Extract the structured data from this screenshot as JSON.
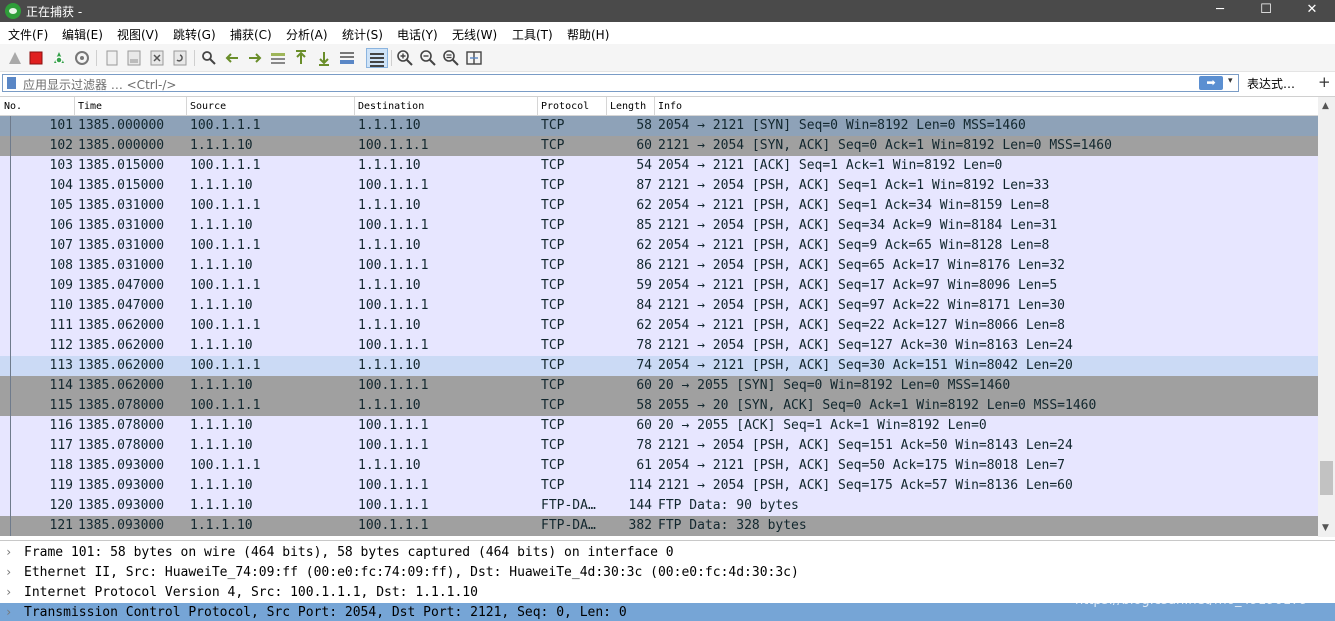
{
  "window": {
    "title": "正在捕获 -",
    "controls": {
      "minimize": "─",
      "maximize": "☐",
      "close": "✕"
    }
  },
  "menu": [
    "文件(F)",
    "编辑(E)",
    "视图(V)",
    "跳转(G)",
    "捕获(C)",
    "分析(A)",
    "统计(S)",
    "电话(Y)",
    "无线(W)",
    "工具(T)",
    "帮助(H)"
  ],
  "filter": {
    "placeholder": "应用显示过滤器 … <Ctrl-/>",
    "apply_icon": "➡",
    "dropdown_icon": "▾",
    "expression_label": "表达式…",
    "add_label": "+"
  },
  "columns": [
    "No.",
    "Time",
    "Source",
    "Destination",
    "Protocol",
    "Length",
    "Info"
  ],
  "colors": {
    "tcp_row": "#e7e6ff",
    "syn_row": "#a0a0a0",
    "selected_row": "#8ea2b8",
    "highlight_row": "#cbdaf5",
    "details_selected": "#76a5d6"
  },
  "packets": [
    {
      "no": "101",
      "time": "1385.000000",
      "src": "100.1.1.1",
      "dst": "1.1.1.10",
      "proto": "TCP",
      "len": "58",
      "info": "2054 → 2121 [SYN] Seq=0 Win=8192 Len=0 MSS=1460",
      "style": "selected"
    },
    {
      "no": "102",
      "time": "1385.000000",
      "src": "1.1.1.10",
      "dst": "100.1.1.1",
      "proto": "TCP",
      "len": "60",
      "info": "2121 → 2054 [SYN, ACK] Seq=0 Ack=1 Win=8192 Len=0 MSS=1460",
      "style": "syn"
    },
    {
      "no": "103",
      "time": "1385.015000",
      "src": "100.1.1.1",
      "dst": "1.1.1.10",
      "proto": "TCP",
      "len": "54",
      "info": "2054 → 2121 [ACK] Seq=1 Ack=1 Win=8192 Len=0",
      "style": "tcp"
    },
    {
      "no": "104",
      "time": "1385.015000",
      "src": "1.1.1.10",
      "dst": "100.1.1.1",
      "proto": "TCP",
      "len": "87",
      "info": "2121 → 2054 [PSH, ACK] Seq=1 Ack=1 Win=8192 Len=33",
      "style": "tcp"
    },
    {
      "no": "105",
      "time": "1385.031000",
      "src": "100.1.1.1",
      "dst": "1.1.1.10",
      "proto": "TCP",
      "len": "62",
      "info": "2054 → 2121 [PSH, ACK] Seq=1 Ack=34 Win=8159 Len=8",
      "style": "tcp"
    },
    {
      "no": "106",
      "time": "1385.031000",
      "src": "1.1.1.10",
      "dst": "100.1.1.1",
      "proto": "TCP",
      "len": "85",
      "info": "2121 → 2054 [PSH, ACK] Seq=34 Ack=9 Win=8184 Len=31",
      "style": "tcp"
    },
    {
      "no": "107",
      "time": "1385.031000",
      "src": "100.1.1.1",
      "dst": "1.1.1.10",
      "proto": "TCP",
      "len": "62",
      "info": "2054 → 2121 [PSH, ACK] Seq=9 Ack=65 Win=8128 Len=8",
      "style": "tcp"
    },
    {
      "no": "108",
      "time": "1385.031000",
      "src": "1.1.1.10",
      "dst": "100.1.1.1",
      "proto": "TCP",
      "len": "86",
      "info": "2121 → 2054 [PSH, ACK] Seq=65 Ack=17 Win=8176 Len=32",
      "style": "tcp"
    },
    {
      "no": "109",
      "time": "1385.047000",
      "src": "100.1.1.1",
      "dst": "1.1.1.10",
      "proto": "TCP",
      "len": "59",
      "info": "2054 → 2121 [PSH, ACK] Seq=17 Ack=97 Win=8096 Len=5",
      "style": "tcp"
    },
    {
      "no": "110",
      "time": "1385.047000",
      "src": "1.1.1.10",
      "dst": "100.1.1.1",
      "proto": "TCP",
      "len": "84",
      "info": "2121 → 2054 [PSH, ACK] Seq=97 Ack=22 Win=8171 Len=30",
      "style": "tcp"
    },
    {
      "no": "111",
      "time": "1385.062000",
      "src": "100.1.1.1",
      "dst": "1.1.1.10",
      "proto": "TCP",
      "len": "62",
      "info": "2054 → 2121 [PSH, ACK] Seq=22 Ack=127 Win=8066 Len=8",
      "style": "tcp"
    },
    {
      "no": "112",
      "time": "1385.062000",
      "src": "1.1.1.10",
      "dst": "100.1.1.1",
      "proto": "TCP",
      "len": "78",
      "info": "2121 → 2054 [PSH, ACK] Seq=127 Ack=30 Win=8163 Len=24",
      "style": "tcp"
    },
    {
      "no": "113",
      "time": "1385.062000",
      "src": "100.1.1.1",
      "dst": "1.1.1.10",
      "proto": "TCP",
      "len": "74",
      "info": "2054 → 2121 [PSH, ACK] Seq=30 Ack=151 Win=8042 Len=20",
      "style": "highlight"
    },
    {
      "no": "114",
      "time": "1385.062000",
      "src": "1.1.1.10",
      "dst": "100.1.1.1",
      "proto": "TCP",
      "len": "60",
      "info": "20 → 2055 [SYN] Seq=0 Win=8192 Len=0 MSS=1460",
      "style": "syn"
    },
    {
      "no": "115",
      "time": "1385.078000",
      "src": "100.1.1.1",
      "dst": "1.1.1.10",
      "proto": "TCP",
      "len": "58",
      "info": "2055 → 20 [SYN, ACK] Seq=0 Ack=1 Win=8192 Len=0 MSS=1460",
      "style": "syn"
    },
    {
      "no": "116",
      "time": "1385.078000",
      "src": "1.1.1.10",
      "dst": "100.1.1.1",
      "proto": "TCP",
      "len": "60",
      "info": "20 → 2055 [ACK] Seq=1 Ack=1 Win=8192 Len=0",
      "style": "tcp"
    },
    {
      "no": "117",
      "time": "1385.078000",
      "src": "1.1.1.10",
      "dst": "100.1.1.1",
      "proto": "TCP",
      "len": "78",
      "info": "2121 → 2054 [PSH, ACK] Seq=151 Ack=50 Win=8143 Len=24",
      "style": "tcp"
    },
    {
      "no": "118",
      "time": "1385.093000",
      "src": "100.1.1.1",
      "dst": "1.1.1.10",
      "proto": "TCP",
      "len": "61",
      "info": "2054 → 2121 [PSH, ACK] Seq=50 Ack=175 Win=8018 Len=7",
      "style": "tcp"
    },
    {
      "no": "119",
      "time": "1385.093000",
      "src": "1.1.1.10",
      "dst": "100.1.1.1",
      "proto": "TCP",
      "len": "114",
      "info": "2121 → 2054 [PSH, ACK] Seq=175 Ack=57 Win=8136 Len=60",
      "style": "tcp"
    },
    {
      "no": "120",
      "time": "1385.093000",
      "src": "1.1.1.10",
      "dst": "100.1.1.1",
      "proto": "FTP-DA…",
      "len": "144",
      "info": "FTP Data: 90 bytes",
      "style": "tcp"
    },
    {
      "no": "121",
      "time": "1385.093000",
      "src": "1.1.1.10",
      "dst": "100.1.1.1",
      "proto": "FTP-DA…",
      "len": "382",
      "info": "FTP Data: 328 bytes",
      "style": "syn"
    }
  ],
  "details": [
    {
      "text": "Frame 101: 58 bytes on wire (464 bits), 58 bytes captured (464 bits) on interface 0",
      "selected": false
    },
    {
      "text": "Ethernet II, Src: HuaweiTe_74:09:ff (00:e0:fc:74:09:ff), Dst: HuaweiTe_4d:30:3c (00:e0:fc:4d:30:3c)",
      "selected": false
    },
    {
      "text": "Internet Protocol Version 4, Src: 100.1.1.1, Dst: 1.1.1.10",
      "selected": false
    },
    {
      "text": "Transmission Control Protocol, Src Port: 2054, Dst Port: 2121, Seq: 0, Len: 0",
      "selected": true
    }
  ],
  "watermark": "https://blog.csdn.net/m0_49190179"
}
